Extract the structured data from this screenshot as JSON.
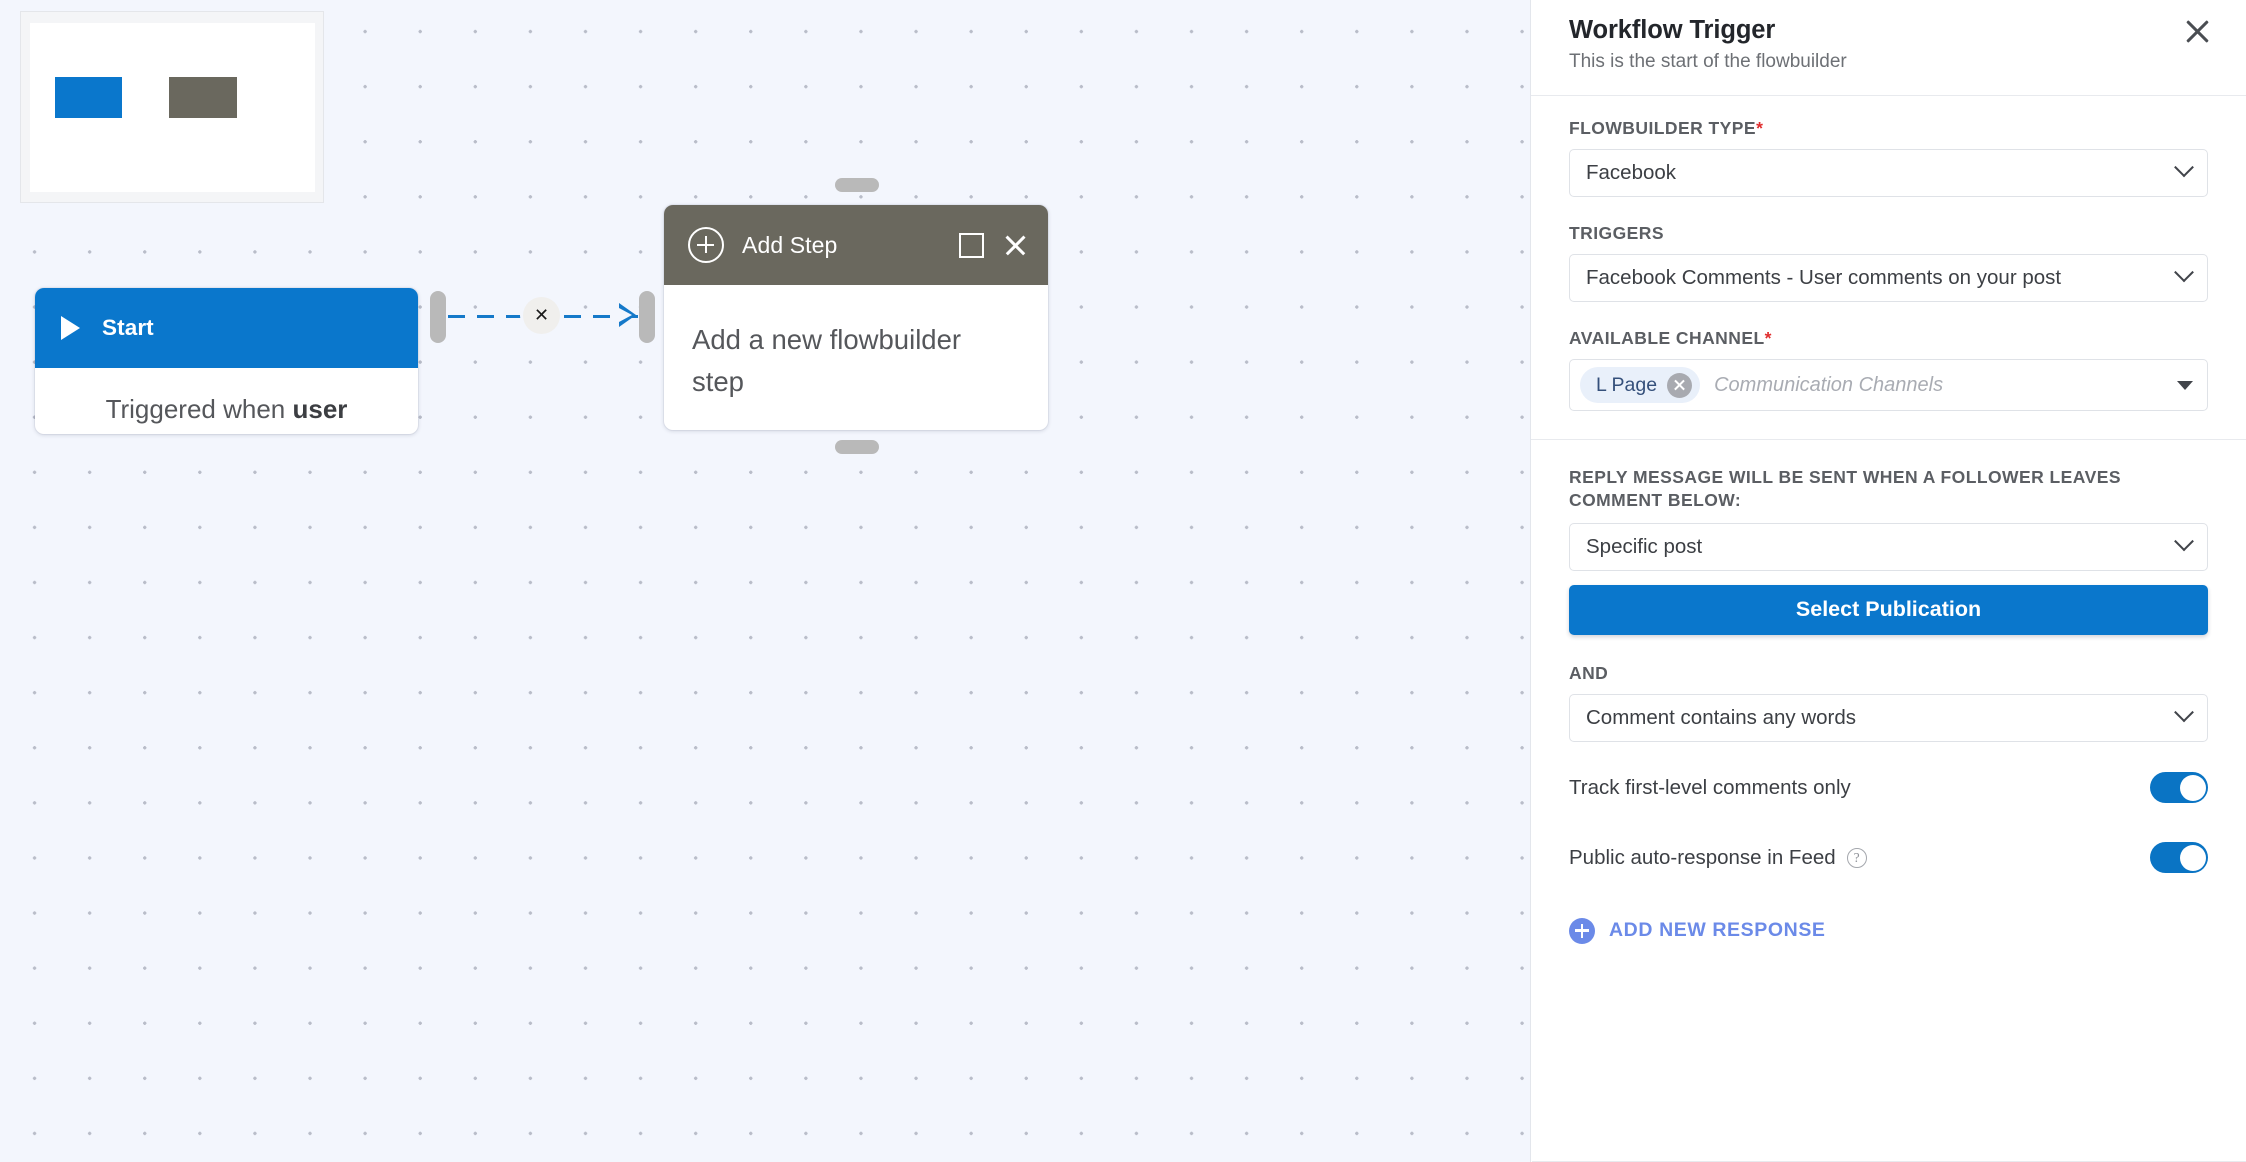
{
  "canvas": {
    "minimap": {
      "name": "flow-minimap",
      "nodes": [
        {
          "type": "start",
          "color": "#0a77cc"
        },
        {
          "type": "add-step",
          "color": "#6a685e"
        }
      ]
    },
    "nodes": [
      {
        "id": "start",
        "header_title": "Start",
        "icon": "play-icon",
        "body_prefix": "Triggered when ",
        "body_bold": "user comments on your Post",
        "header_color": "#0a77cc"
      },
      {
        "id": "add-step",
        "header_title": "Add Step",
        "icon": "plus-circle-icon",
        "body": "Add a new flowbuilder step",
        "header_color": "#6a685e",
        "actions": [
          "duplicate-icon",
          "close-icon"
        ]
      }
    ],
    "connector": {
      "delete_glyph": "✕",
      "line_color": "#1579c9"
    }
  },
  "panel": {
    "title": "Workflow Trigger",
    "subtitle": "This is the start of the flowbuilder",
    "close_icon": "close-icon",
    "fields": {
      "flowbuilder_type": {
        "label": "FLOWBUILDER TYPE",
        "required": "*",
        "value": "Facebook"
      },
      "triggers": {
        "label": "TRIGGERS",
        "required": "",
        "value": "Facebook Comments - User comments on your post"
      },
      "available_channel": {
        "label": "AVAILABLE CHANNEL",
        "required": "*",
        "tag": "L Page",
        "placeholder": "Communication Channels"
      },
      "reply_message": {
        "label": "REPLY MESSAGE WILL BE SENT WHEN A FOLLOWER LEAVES COMMENT BELOW:",
        "value": "Specific post"
      },
      "select_publication": {
        "label": "Select Publication"
      },
      "and": {
        "label": "AND",
        "value": "Comment contains any words"
      }
    },
    "toggles": [
      {
        "label": "Track first-level comments only",
        "state": "on",
        "has_help": false
      },
      {
        "label": "Public auto-response in Feed",
        "state": "on",
        "has_help": true,
        "help_glyph": "?"
      }
    ],
    "add_response": {
      "label": "ADD NEW RESPONSE",
      "icon": "plus-circle-icon"
    }
  },
  "colors": {
    "accent_blue": "#0a77cc",
    "node_gray": "#6a685e",
    "link_blue": "#6b8ae8",
    "required_red": "#e02d2d",
    "canvas_bg": "#f3f6fd"
  }
}
